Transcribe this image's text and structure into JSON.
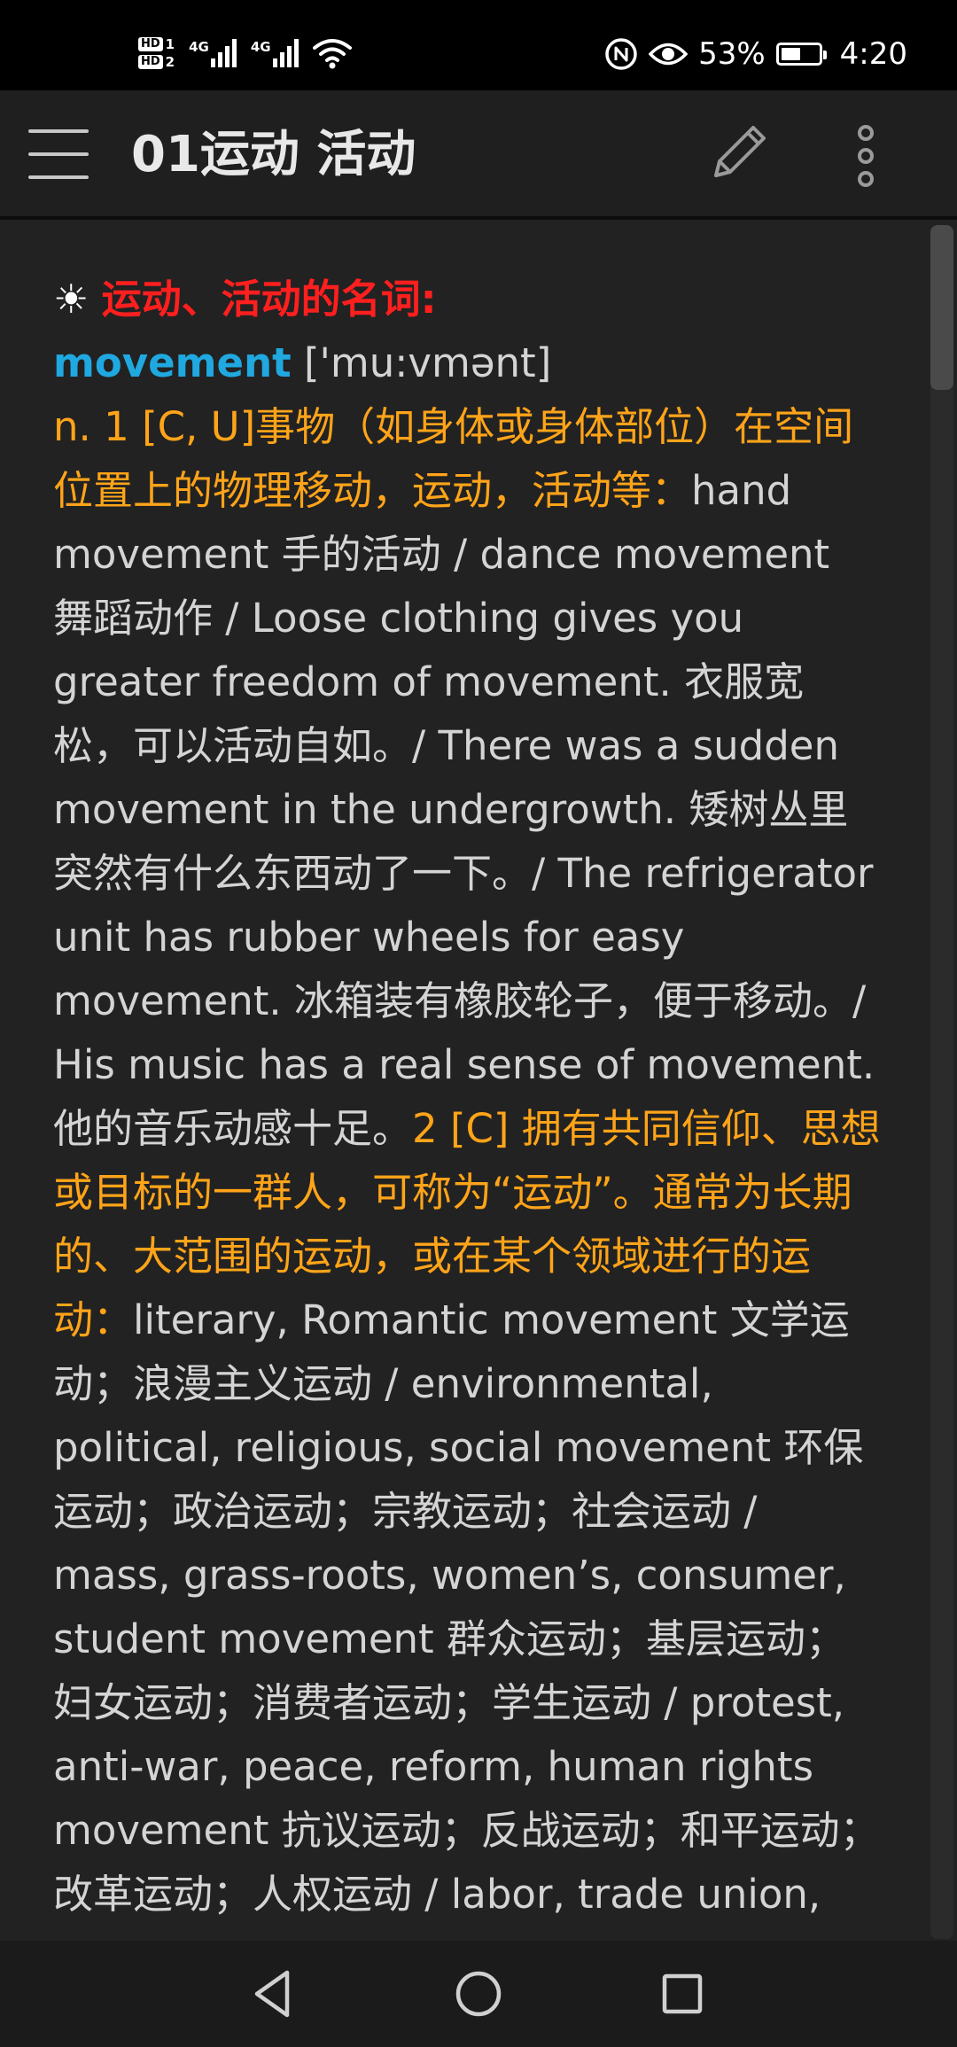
{
  "status_bar": {
    "sim1": "1",
    "sim2": "2",
    "hd_label": "HD",
    "network_1": "4G",
    "network_2": "4G",
    "battery_percent": "53%",
    "battery_level": 0.53,
    "time": "4:20",
    "icons": [
      "signal-icon",
      "wifi-icon",
      "nfc-icon",
      "eye-comfort-icon",
      "battery-icon"
    ]
  },
  "app_bar": {
    "title": "01运动 活动",
    "icons": [
      "menu-icon",
      "edit-icon",
      "more-vert-icon"
    ]
  },
  "entry": {
    "sun_symbol": "☀",
    "heading": "运动、活动的名词:",
    "word": "movement",
    "phonetic": "['mu:vmənt]",
    "sense1_definition": "n. 1 [C, U]事物（如身体或身体部位）在空间位置上的物理移动，运动，活动等：",
    "sense1_examples": "hand movement 手的活动 / dance movement 舞蹈动作 / Loose clothing gives you greater freedom of movement. 衣服宽松，可以活动自如。/ There was a sudden movement in the undergrowth. 矮树丛里突然有什么东西动了一下。/ The refrigerator unit has rubber wheels for easy movement. 冰箱装有橡胶轮子，便于移动。/ His music has a real sense of movement. 他的音乐动感十足。",
    "sense2_definition": "2 [C] 拥有共同信仰、思想或目标的一群人，可称为“运动”。通常为长期的、大范围的运动，或在某个领域进行的运动：",
    "sense2_examples": "literary, Romantic movement 文学运动；浪漫主义运动 / environmental, political, religious, social movement 环保运动；政治运动；宗教运动；社会运动 / mass, grass-roots, women’s, consumer, student movement 群众运动；基层运动；妇女运动；消费者运动；学生运动 / protest, anti-war, peace, reform, human rights movement 抗议运动；反战运动；和平运动；改革运动；人权运动 / labor, trade union, resistance movement"
  },
  "nav_bar": {
    "icons": [
      "back-icon",
      "home-icon",
      "recents-icon"
    ]
  },
  "colors": {
    "background": "#222222",
    "heading_red": "#ff1f1f",
    "word_blue": "#20a8e0",
    "definition_orange": "#ffa419",
    "body_text": "#d4d4d4"
  }
}
